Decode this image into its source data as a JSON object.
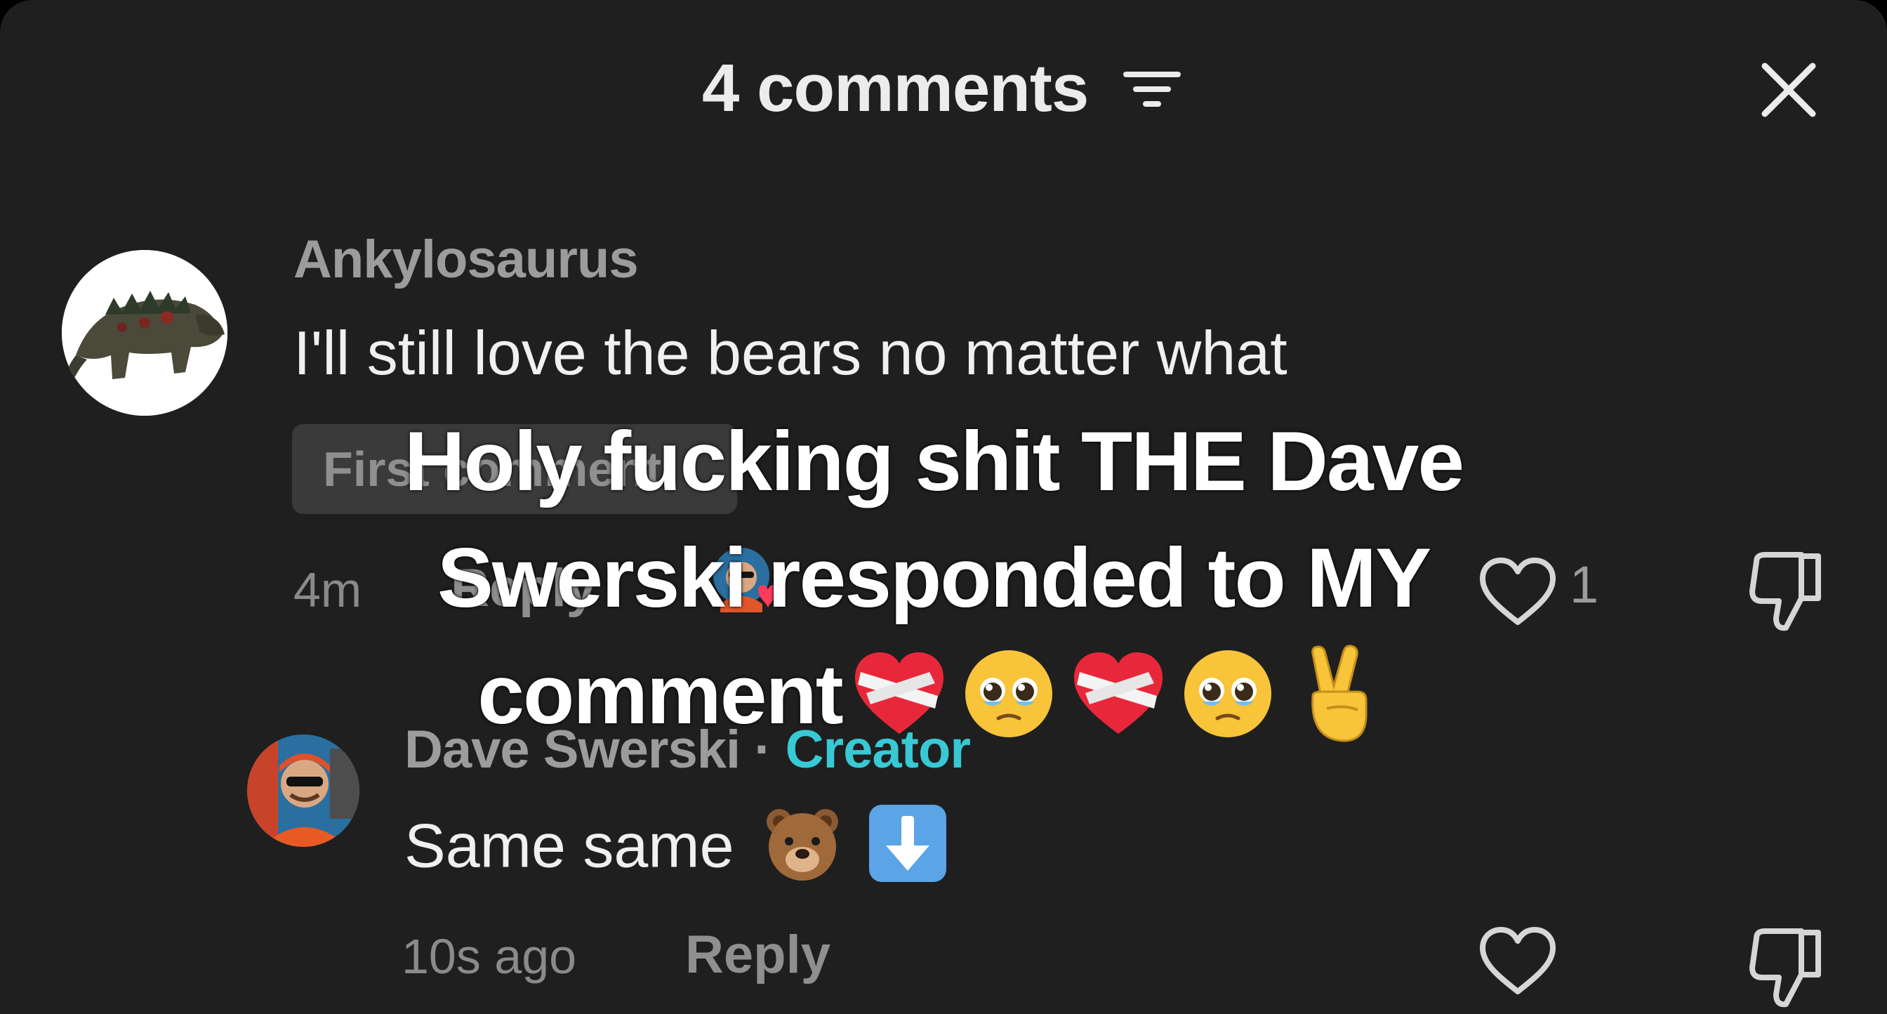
{
  "header": {
    "title": "4 comments"
  },
  "comments": [
    {
      "username": "Ankylosaurus",
      "text": "I'll still love the bears no matter what",
      "badge": "First comment",
      "time": "4m",
      "reply_label": "Reply",
      "like_count": "1"
    },
    {
      "username": "Dave Swerski",
      "separator": "·",
      "creator_label": "Creator",
      "text": "Same same",
      "emojis": [
        "bear-face",
        "down-arrow"
      ],
      "time": "10s ago",
      "reply_label": "Reply"
    }
  ],
  "overlay": {
    "line1": "Holy fucking shit THE Dave",
    "line2": "Swerski responded to MY",
    "line3": "comment",
    "emojis": [
      "mending-heart",
      "pleading-face",
      "mending-heart",
      "pleading-face",
      "victory-hand"
    ]
  },
  "colors": {
    "sheet_bg": "#1f1f1f",
    "creator_accent": "#38c9d5",
    "muted_text": "#9c9c9c"
  }
}
